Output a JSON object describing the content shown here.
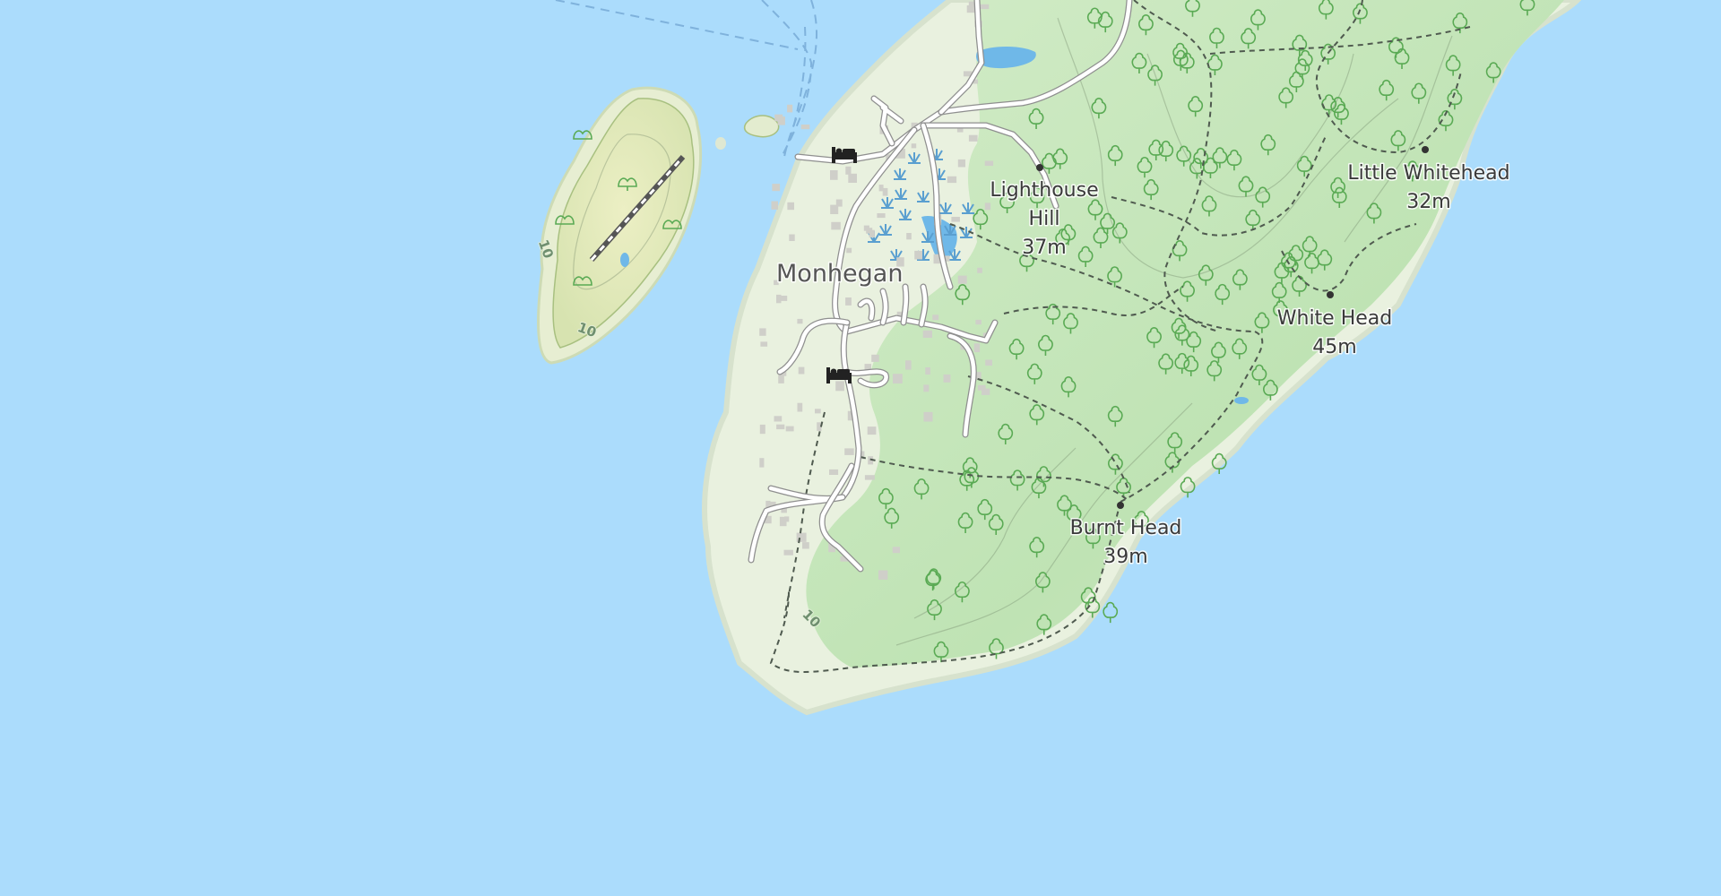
{
  "map": {
    "water_color": "#abdcfc",
    "land_color": "#e9f1df",
    "forest_color": "#c8e8c0",
    "places": [
      {
        "id": "monhegan",
        "name": "Monhegan"
      }
    ],
    "peaks": [
      {
        "id": "lighthouse-hill",
        "name_line1": "Lighthouse",
        "name_line2": "Hill",
        "elevation": "37m"
      },
      {
        "id": "little-whitehead",
        "name_line1": "Little Whitehead",
        "name_line2": "",
        "elevation": "32m"
      },
      {
        "id": "white-head",
        "name_line1": "White Head",
        "name_line2": "",
        "elevation": "45m"
      },
      {
        "id": "burnt-head",
        "name_line1": "Burnt Head",
        "name_line2": "",
        "elevation": "39m"
      }
    ],
    "contour_labels": [
      "10",
      "10",
      "10"
    ],
    "icons": [
      "lodging-icon",
      "lodging-icon"
    ]
  }
}
